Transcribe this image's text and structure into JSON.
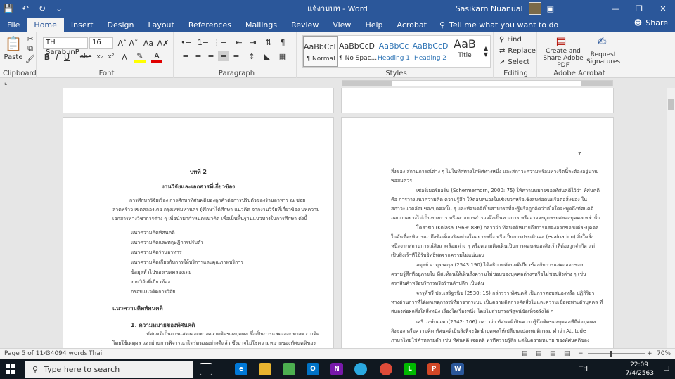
{
  "titlebar": {
    "doc_title": "แจ้งามบท - Word",
    "user_name": "Sasikarn Nuanual"
  },
  "tabs": [
    {
      "label": "File"
    },
    {
      "label": "Home"
    },
    {
      "label": "Insert"
    },
    {
      "label": "Design"
    },
    {
      "label": "Layout"
    },
    {
      "label": "References"
    },
    {
      "label": "Mailings"
    },
    {
      "label": "Review"
    },
    {
      "label": "View"
    },
    {
      "label": "Help"
    },
    {
      "label": "Acrobat"
    }
  ],
  "tell_me": "Tell me what you want to do",
  "share_label": "Share",
  "ribbon": {
    "clipboard": {
      "paste": "Paste",
      "label": "Clipboard"
    },
    "font": {
      "name": "TH SarabunP",
      "size": "16",
      "label": "Font"
    },
    "paragraph": {
      "label": "Paragraph"
    },
    "styles": {
      "label": "Styles",
      "items": [
        {
          "preview": "AaBbCcDc",
          "name": "¶ Normal"
        },
        {
          "preview": "AaBbCcDc",
          "name": "¶ No Spac..."
        },
        {
          "preview": "AaBbCc",
          "name": "Heading 1"
        },
        {
          "preview": "AaBbCcD",
          "name": "Heading 2"
        },
        {
          "preview": "AaB",
          "name": "Title"
        }
      ]
    },
    "editing": {
      "find": "Find",
      "replace": "Replace",
      "select": "Select",
      "label": "Editing"
    },
    "acrobat": {
      "create": "Create and Share Adobe PDF",
      "request": "Request Signatures",
      "label": "Adobe Acrobat"
    }
  },
  "page_left": {
    "chapter": "บทที่ 2",
    "title": "งานวิจัยและเอกสารที่เกี่ยวข้อง",
    "intro1": "การศึกษาวิจัยเรื่อง การศึกษาทัศนคติของลูกค้าต่อการปรับตัวของร้านอาหาร ณ ซอย",
    "intro2": "ลาดพร้าว เขตคลองเตย กรุงเทพมหานคร ผู้ศึกษาได้ศึกษา แนวคิด จากงานวิจัยที่เกี่ยวข้อง บทความ",
    "intro3": "เอกสารทางวิชาการต่าง ๆ เพื่อนำมากำหนดแนวคิด เพื่อเป็นพื้นฐานแนวทางในการศึกษา ดังนี้",
    "list": [
      "แนวความคิดทัศนคติ",
      "แนวความคิดและทฤษฎีการปรับตัว",
      "แนวความคิดร้านอาหาร",
      "แนวความคิดเกี่ยวกับการให้บริการและคุณภาพบริการ",
      "ข้อมูลทั่วไปของเขตคลองเตย",
      "งานวิจัยที่เกี่ยวข้อง",
      "กรอบแนวคิดการวิจัย"
    ],
    "section": "แนวความคิดทัศนคติ",
    "sub": "1. ความหมายของทัศนคติ",
    "p1": "ทัศนคติเป็นการแสดงออกทางความคิดของบุคคล ซึ่งเป็นการแสดงออกทางความคิด",
    "p2": "โดยใช้เหตุผล และผ่านการพิจารณาไตร่ตรองอย่างดีแล้ว ซึ่งอาจไม่ใช่ความหมายของทัศนคติของ"
  },
  "page_right": {
    "page_num": "7",
    "lines": [
      "สิ่งของ สถานการณ์ต่าง ๆ ไปในทิศทางใดทิศทางหนึ่ง และสภาวะความพร้อมทางจิตนี้จะต้องอยู่นาน",
      "พอสมควร",
      "เชอร์เมอร์ฮอร์น (Schermerhorn, 2000: 75) ให้ความหมายของทัศนคติไว้ว่า ทัศนคติ",
      "คือ การวางแนวความคิด ความรู้สึก ให้ตอบสนองในเชิงบวกหรือเชิงลบต่อคนหรือต่อสิ่งของ ใน",
      "สภาวะแวดล้อมของบุคคลนั้น ๆ และทัศนคติเป็นสามารถที่จะรู้หรือถูกคิดว่าเมื่อใดจะพูดถึงทัศนคติ",
      "ออกมาอย่างไม่เป็นทางการ หรืออาจการสำรวจจึงเป็นทางการ หรืออาจจะถูกทรยศของบุคคลเหล่านั้น",
      "โคลาซา (Kolasa 1969: 886) กล่าวว่า ทัศนคติหมายถึงการแสดงออกของแต่ละบุคคล",
      "ในอันที่จะพิจารณาถึงข้อเท็จจริงอย่างใดอย่างหนึ่ง หรือเป็นการประเมินผล (evaluation) สิ่งใดสิ่ง",
      "หนึ่งจากสถานการณ์สิ่งแวดล้อมต่าง ๆ หรือความคิดเห็นเป็นการตอบสนองสิ่งเร้าที่ต้องถูกจำกัด แต่",
      "เป็นสิ่งเร้าที่ใช้รับอิทธิพลจากความไม่แน่นอน",
      "อดุลย์ จาตุรงคกุล (2543:190) ได้อธิบายทัศนคติเกี่ยวข้องกับการแสดงออกของ",
      "ความรู้สึกที่อยู่ภายใน ที่สะท้อนให้เห็นถึงความไม่ชอบของบุคคลต่างๆหรือไม่ชอบสิ่งต่าง ๆ เช่น",
      "ตราสินค้าหรือบริการหรือร้านค้าปลีก เป็นต้น",
      "จารุพัชรี ประเสริฐวนิช (2530: 15) กล่าวว่า ทัศนคติ เป็นการตอบสนองหรือ ปฏิกิริยา",
      "ทางด้านการที่ได้ผลเหตุการณ์ที่มาจากระบบ เป็นความคิดการคิดสิ่งในและความเชื่อเฉพาะตัวบุคคล ที่",
      "สนองต่อผลสิ่งใดสิ่งหนึ่ง เรื่องใดเรื่องหนึ่ง โดยไม่สามารถพิสูจน์ข้อเท็จจริงได้ ๆ",
      "เสรี วงษ์มณฑา(2542: 106) กล่าวว่า ทัศนคติเป็นความรู้นึกคิดของบุคคลที่มีต่อบุคคล",
      "สิ่งของ หรือความคิด ทัศนคติเป็นสิ่งที่จะจัดนำบุคคลให้เปลี่ยนแปลงพฤติกรรม คำว่า Attitude",
      "ภาษาไทยใช้คำหลายคำ เช่น ทัศนคติ เจตคติ ท่าทีความรู้สึก แต่ในความหมาย ของทัศนคติของ"
    ]
  },
  "status": {
    "page": "Page 5 of 114",
    "words": "34094 words",
    "lang": "Thai",
    "zoom": "70%"
  },
  "taskbar": {
    "search_placeholder": "Type here to search",
    "lang": "TH",
    "time": "22:09",
    "date": "7/4/2563"
  }
}
